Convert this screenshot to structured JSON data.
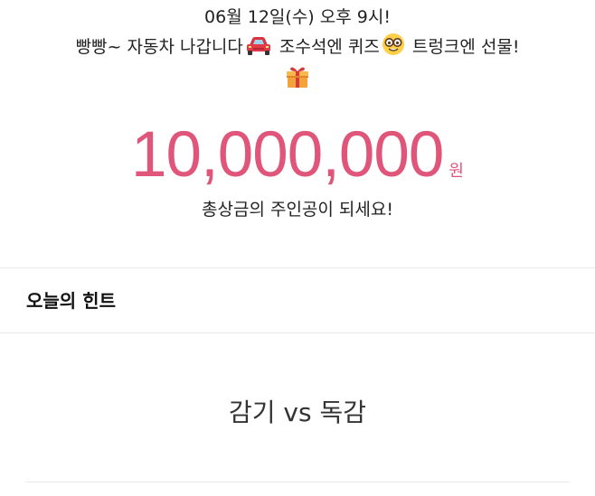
{
  "announcement": {
    "date_line": "06월 12일(수) 오후 9시!",
    "line2_part1": "빵빵~ 자동차 나갑니다",
    "line2_part2": " 조수석엔 퀴즈",
    "line2_part3": " 트렁크엔 선물!",
    "emojis": [
      "car-emoji",
      "nerd-face-emoji",
      "gift-emoji"
    ]
  },
  "prize": {
    "amount": "10,000,000",
    "unit": "원",
    "caption": "총상금의 주인공이 되세요!",
    "color": "#e0567a"
  },
  "hint": {
    "title": "오늘의 힌트",
    "text": "감기 vs 독감"
  }
}
